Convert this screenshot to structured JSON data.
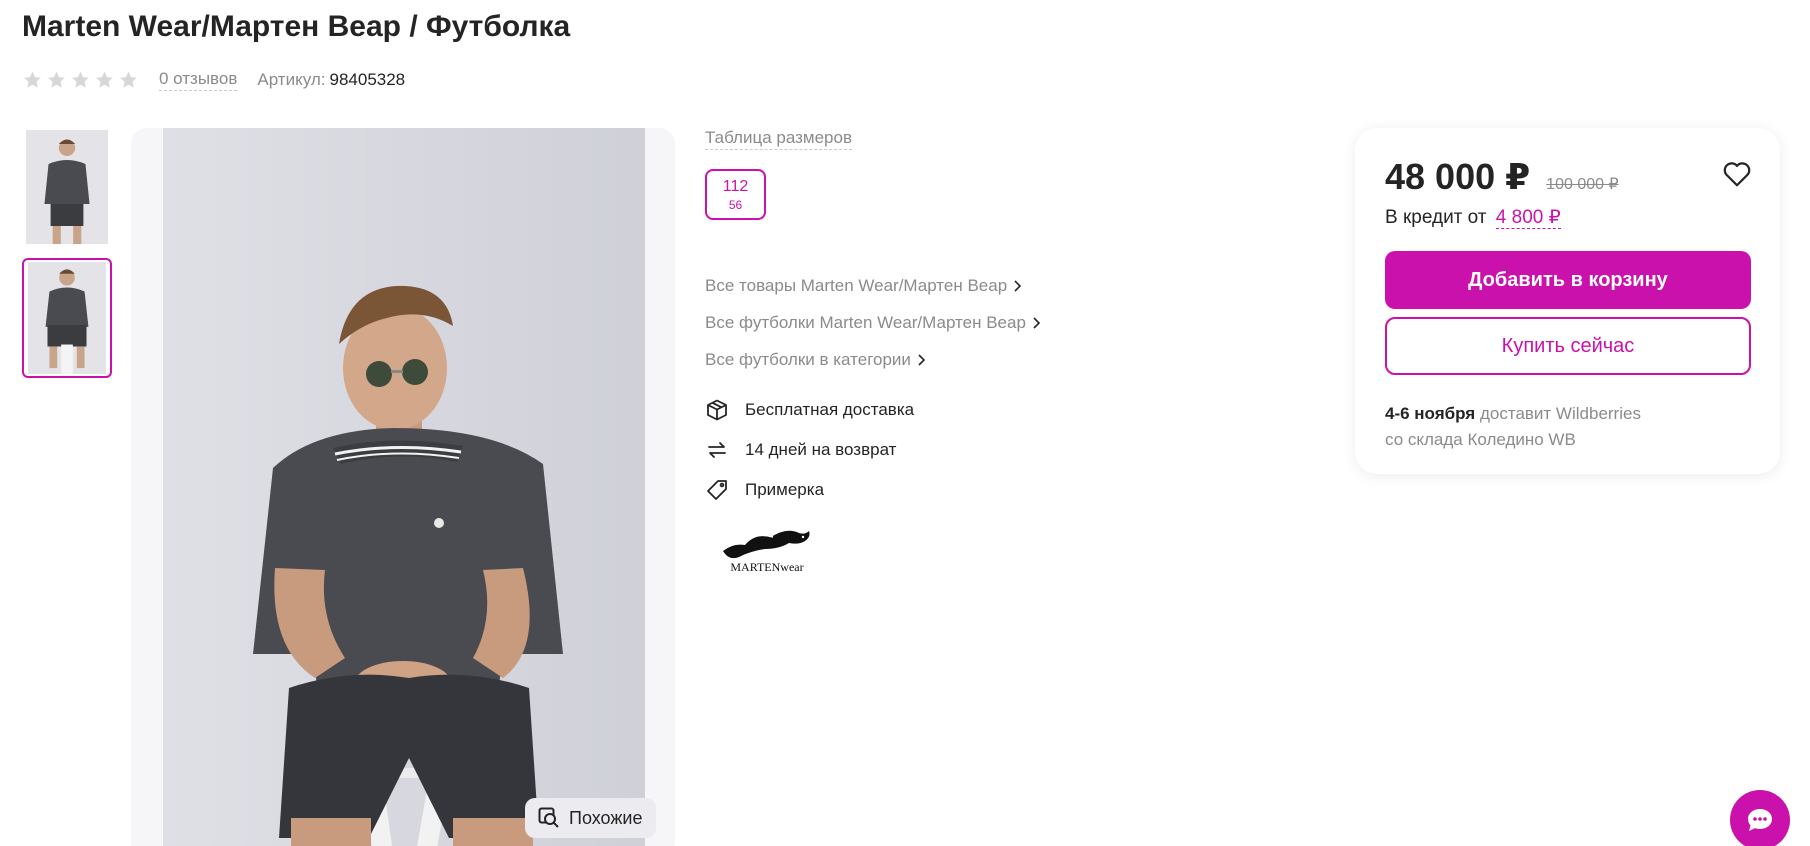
{
  "product": {
    "title": "Marten Wear/Мартен Веар / Футболка",
    "rating_stars": 0,
    "reviews": "0 отзывов",
    "article_label": "Артикул:",
    "article_value": "98405328"
  },
  "gallery": {
    "similar_label": "Похожие",
    "thumbnails": [
      "thumb-1",
      "thumb-2"
    ],
    "selected_thumbnail": 2
  },
  "sizes": {
    "table_label": "Таблица размеров",
    "items": [
      {
        "primary": "112",
        "secondary": "56",
        "selected": true
      }
    ]
  },
  "links": [
    {
      "label": "Все товары Marten Wear/Мартен Веар"
    },
    {
      "label": "Все футболки Marten Wear/Мартен Веар"
    },
    {
      "label": "Все футболки в категории"
    }
  ],
  "features": [
    {
      "icon": "box-icon",
      "label": "Бесплатная доставка"
    },
    {
      "icon": "return-icon",
      "label": "14 дней на возврат"
    },
    {
      "icon": "tag-icon",
      "label": "Примерка"
    }
  ],
  "brand": {
    "logo_text": "MARTENwear"
  },
  "buy_card": {
    "price": "48 000 ₽",
    "old_price": "100 000 ₽",
    "credit_label": "В кредит от",
    "credit_amount": "4 800 ₽",
    "add_to_cart": "Добавить в корзину",
    "buy_now": "Купить сейчас",
    "delivery_dates": "4-6 ноября",
    "delivery_by": "доставит Wildberries",
    "delivery_from": "со склада Коледино WB"
  },
  "colors": {
    "accent": "#cb11ab",
    "text": "#242424",
    "muted": "#8b8b8b"
  }
}
